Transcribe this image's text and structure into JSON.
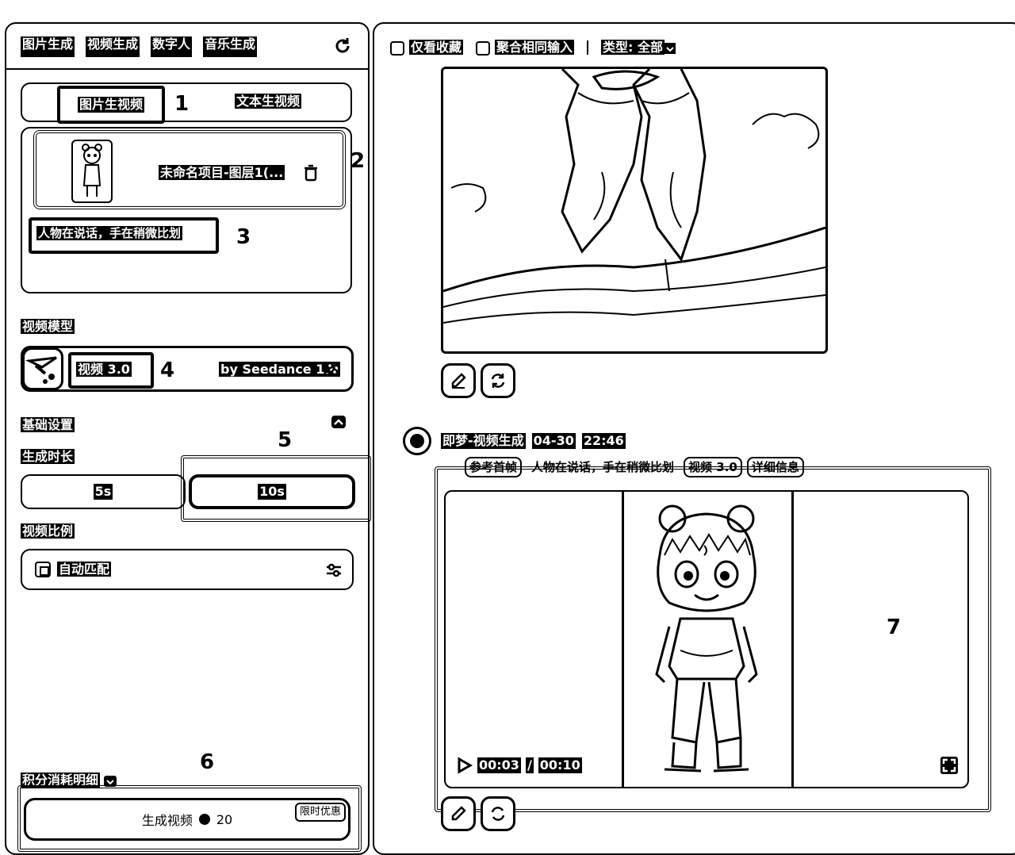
{
  "left": {
    "tabs": [
      "图片生成",
      "视频生成",
      "数字人",
      "音乐生成"
    ],
    "mode_tabs": {
      "image_to_video": "图片生视频",
      "text_to_video": "文本生视频"
    },
    "upload": {
      "name": "未命名项目-图层1(..."
    },
    "prompt": "人物在说话，手在稍微比划",
    "model_section_label": "视频模型",
    "model": {
      "name": "视频 3.0",
      "provider": "by Seedance 1.0"
    },
    "basic_settings_label": "基础设置",
    "duration_label": "生成时长",
    "durations": [
      "5s",
      "10s"
    ],
    "ratio_label": "视频比例",
    "ratio_value": "自动匹配",
    "points_label": "积分消耗明细",
    "generate": {
      "label": "生成视频",
      "cost": "20",
      "badge": "限时优惠"
    }
  },
  "right": {
    "filters": {
      "favorites": "仅看收藏",
      "merge": "聚合相同输入",
      "type": "类型: 全部"
    },
    "record": {
      "title": "即梦-视频生成",
      "date": "04-30",
      "time": "22:46",
      "tags": [
        "参考首帧",
        "人物在说话，手在稍微比划",
        "视频 3.0",
        "详细信息"
      ]
    },
    "player": {
      "current": "00:03",
      "total": "00:10"
    }
  },
  "markers": [
    "1",
    "2",
    "3",
    "4",
    "5",
    "6",
    "7"
  ]
}
